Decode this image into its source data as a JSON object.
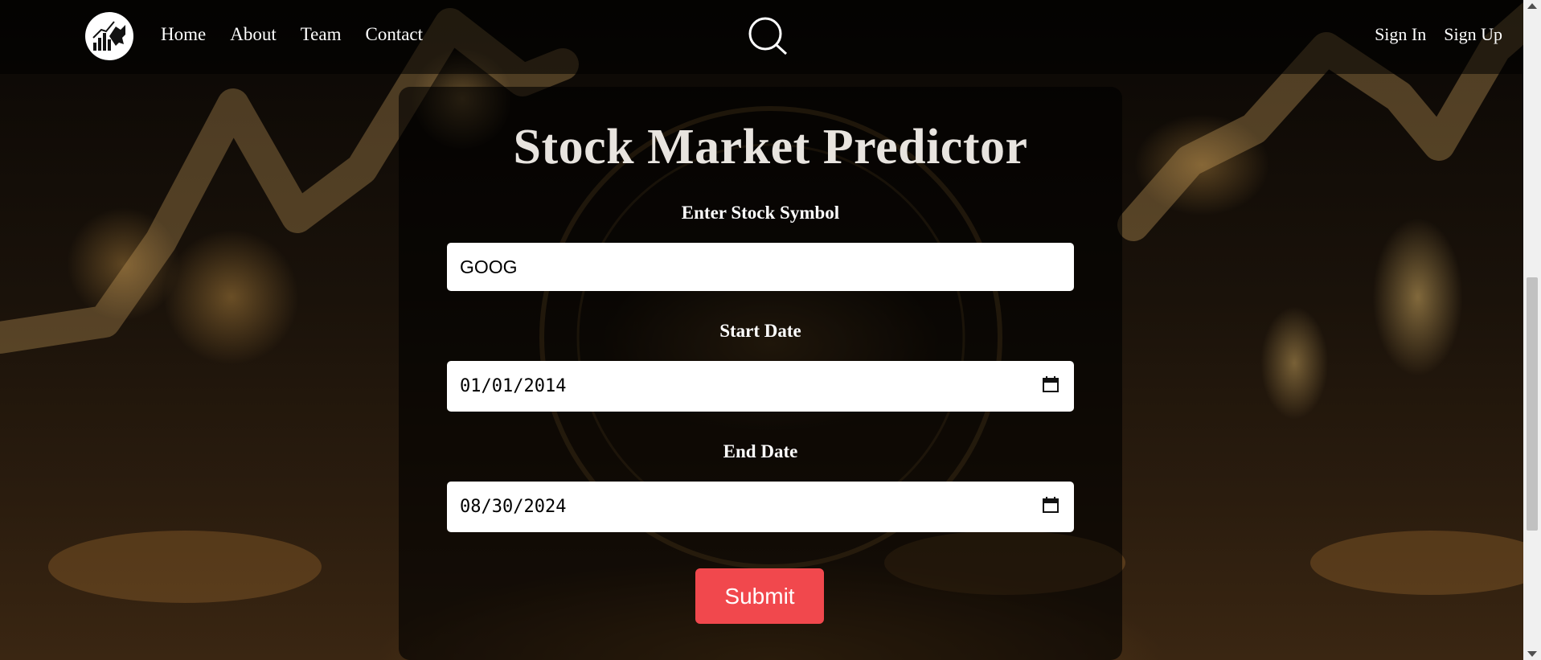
{
  "nav": {
    "links": [
      "Home",
      "About",
      "Team",
      "Contact"
    ],
    "sign_in": "Sign In",
    "sign_up": "Sign Up"
  },
  "form": {
    "title": "Stock Market Predictor",
    "symbol_label": "Enter Stock Symbol",
    "symbol_value": "GOOG",
    "start_label": "Start Date",
    "start_value": "01/01/2014",
    "end_label": "End Date",
    "end_value": "08/30/2024",
    "submit_label": "Submit"
  },
  "colors": {
    "submit": "#f1484d",
    "card_bg": "rgba(0,0,0,0.62)"
  },
  "icons": {
    "logo": "bull-chart-logo-icon",
    "search": "search-icon",
    "calendar": "calendar-icon"
  }
}
